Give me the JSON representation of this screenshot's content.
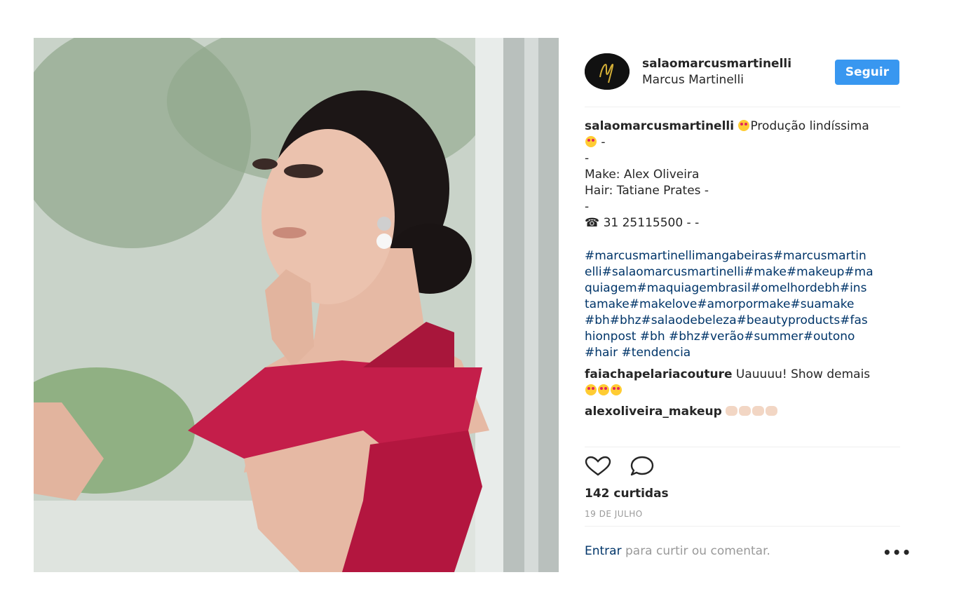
{
  "post": {
    "image_alt": "Woman in red off-shoulder dress"
  },
  "header": {
    "username": "salaomarcusmartinelli",
    "full_name": "Marcus Martinelli",
    "follow_label": "Seguir"
  },
  "caption": {
    "username": "salaomarcusmartinelli",
    "line1_text": "Produção lindíssima",
    "line2_text": "-",
    "line3_text": "-",
    "make": "Make: Alex Oliveira",
    "hair": "Hair: Tatiane Prates -",
    "line6_text": "-",
    "phone": "☎ 31 25115500 - -",
    "hashtags": [
      "#marcusmartinellimangabeiras#marcusmartin",
      "elli#salaomarcusmartinelli#make#makeup#ma",
      "quiagem#maquiagembrasil#omelhordebh#ins",
      "tamake#makelove#amorpormake#suamake",
      "#bh#bhz#salaodebeleza#beautyproducts#fas",
      "hionpost #bh #bhz#verão#summer#outono",
      "#hair #tendencia"
    ]
  },
  "comments": [
    {
      "username": "faiachapelariacouture",
      "text": "Uauuuu! Show demais"
    },
    {
      "username": "alexoliveira_makeup",
      "text": ""
    }
  ],
  "actions": {
    "like_icon": "heart-icon",
    "comment_icon": "comment-bubble-icon"
  },
  "likes": "142 curtidas",
  "date": "19 DE JULHO",
  "footer": {
    "login_link": "Entrar",
    "login_rest": " para curtir ou comentar.",
    "more_label": "•••"
  },
  "colors": {
    "follow_button": "#3897f0",
    "hashtag": "#003569",
    "dress": "#c41e4a"
  }
}
